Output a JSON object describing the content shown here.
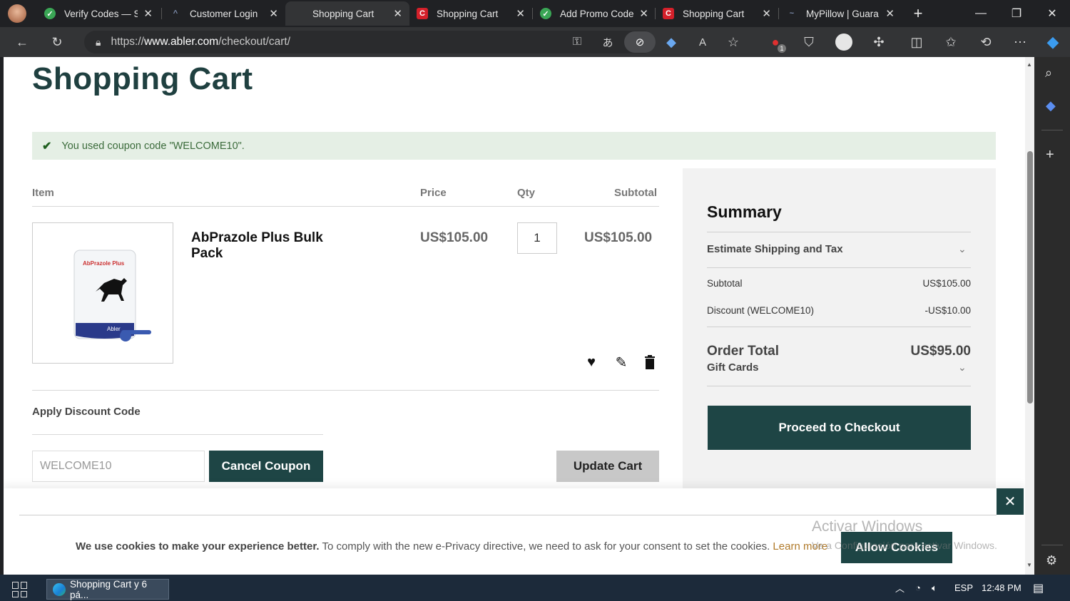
{
  "browser": {
    "tabs": [
      {
        "label": "Verify Codes — S",
        "icon": "green-check-icon"
      },
      {
        "label": "Customer Login",
        "icon": "abler-logo-icon"
      },
      {
        "label": "Shopping Cart",
        "icon": "none",
        "active": true
      },
      {
        "label": "Shopping Cart",
        "icon": "red-c-icon"
      },
      {
        "label": "Add Promo Code",
        "icon": "green-check-icon"
      },
      {
        "label": "Shopping Cart",
        "icon": "red-c-icon"
      },
      {
        "label": "MyPillow | Guara",
        "icon": "mypillow-logo-icon"
      }
    ],
    "url_scheme": "https://",
    "url_domain": "www.abler.com",
    "url_path": "/checkout/cart/",
    "notification_count": "1"
  },
  "page": {
    "title": "Shopping Cart",
    "coupon_message": "You used coupon code \"WELCOME10\".",
    "table_headers": {
      "item": "Item",
      "price": "Price",
      "qty": "Qty",
      "subtotal": "Subtotal"
    },
    "item": {
      "name": "AbPrazole Plus Bulk Pack",
      "package_brand": "AbPrazole Plus",
      "package_logo": "Abler",
      "price": "US$105.00",
      "qty": "1",
      "subtotal": "US$105.00"
    },
    "discount": {
      "label": "Apply Discount Code",
      "code_value": "WELCOME10",
      "cancel_label": "Cancel Coupon",
      "update_label": "Update Cart"
    },
    "summary": {
      "title": "Summary",
      "estimate_label": "Estimate Shipping and Tax",
      "subtotal_label": "Subtotal",
      "subtotal_value": "US$105.00",
      "discount_label": "Discount (WELCOME10)",
      "discount_value": "-US$10.00",
      "order_total_label": "Order Total",
      "order_total_value": "US$95.00",
      "gift_cards_label": "Gift Cards",
      "checkout_label": "Proceed to Checkout"
    },
    "cookie": {
      "bold": "We use cookies to make your experience better.",
      "text": " To comply with the new e-Privacy directive, we need to ask for your consent to set the cookies.",
      "learn_more": "Learn more",
      "allow_label": "Allow Cookies"
    },
    "watermark": {
      "line1": "Activar Windows",
      "line2": "Ve a Configuración para activar Windows."
    }
  },
  "taskbar": {
    "app_label": "Shopping Cart y 6 pá...",
    "language": "ESP",
    "time": "12:48 PM"
  },
  "colors": {
    "brand_dark": "#1e4545",
    "success_bg": "#e5efe5",
    "taskbar": "#1c2a3a"
  }
}
